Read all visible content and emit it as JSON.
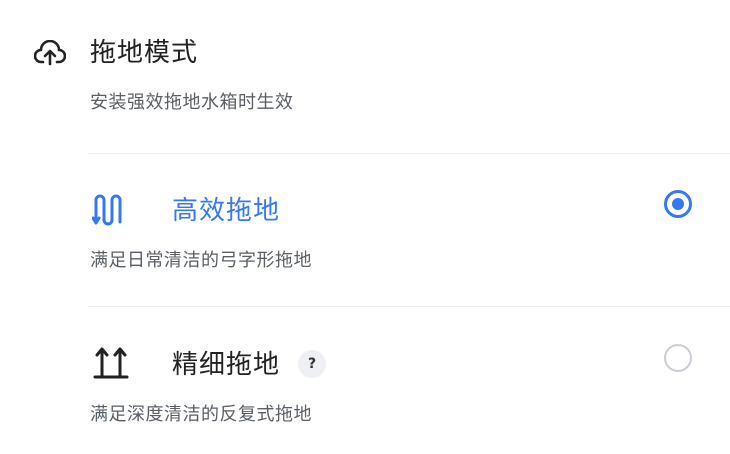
{
  "section": {
    "title": "拖地模式",
    "subtitle": "安装强效拖地水箱时生效",
    "icon": "cloud-upload-icon"
  },
  "options": [
    {
      "title": "高效拖地",
      "description": "满足日常清洁的弓字形拖地",
      "icon": "zigzag-mop-icon",
      "selected": true,
      "title_color": "#3478f6"
    },
    {
      "title": "精细拖地",
      "description": "满足深度清洁的反复式拖地",
      "icon": "back-and-forth-mop-icon",
      "selected": false,
      "help_label": "?",
      "title_color": "#222222"
    }
  ],
  "colors": {
    "accent": "#3478f6",
    "radio_unchecked": "#c8cdd4",
    "divider": "#ebedf0"
  }
}
